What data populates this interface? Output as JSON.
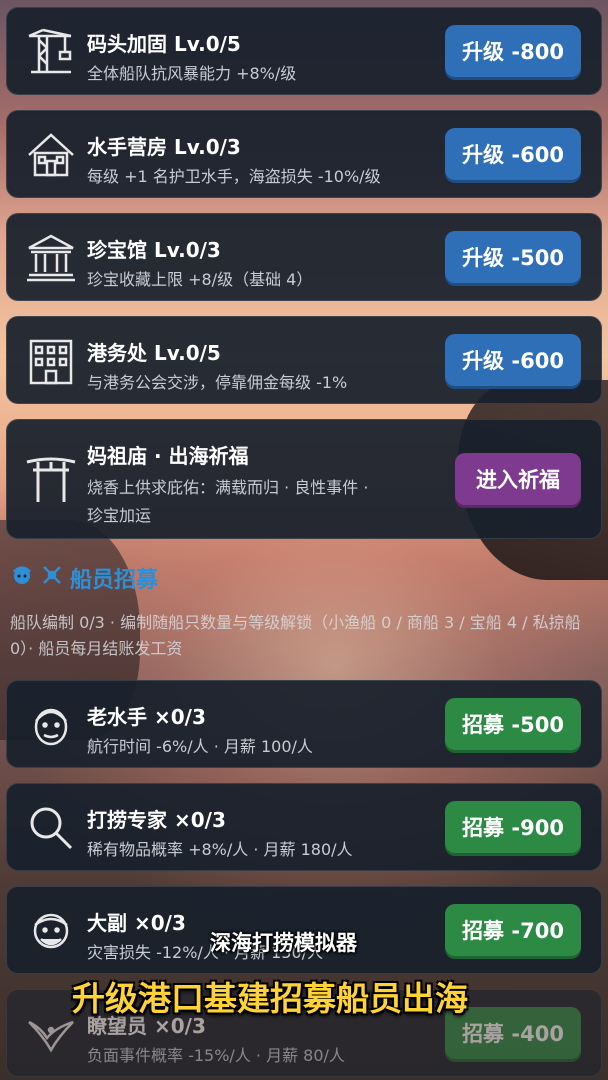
{
  "facilities": [
    {
      "icon": "crane-icon",
      "title": "码头加固 Lv.0/5",
      "desc": "全体船队抗风暴能力 +8%/级",
      "button": "升级 -800"
    },
    {
      "icon": "house-icon",
      "title": "水手营房 Lv.0/3",
      "desc": "每级 +1 名护卫水手，海盗损失 -10%/级",
      "button": "升级 -600"
    },
    {
      "icon": "museum-icon",
      "title": "珍宝馆 Lv.0/3",
      "desc": "珍宝收藏上限 +8/级（基础 4）",
      "button": "升级 -500"
    },
    {
      "icon": "office-building-icon",
      "title": "港务处 Lv.0/5",
      "desc": "与港务公会交涉，停靠佣金每级 -1%",
      "button": "升级 -600"
    }
  ],
  "temple": {
    "icon": "torii-gate-icon",
    "title": "妈祖庙 · 出海祈福",
    "desc_line1": "烧香上供求庇佑：满载而归 · 良性事件 ·",
    "desc_line2": "珍宝加运",
    "button": "进入祈福"
  },
  "crew_section": {
    "title": "船员招募",
    "desc": "船队编制 0/3 · 编制随船只数量与等级解锁（小渔船 0 / 商船 3 / 宝船 4 / 私掠船 0）· 船员每月结账发工资"
  },
  "crew": [
    {
      "icon": "sailor-face-icon",
      "title": "老水手 ×0/3",
      "desc": "航行时间 -6%/人 · 月薪 100/人",
      "button": "招募 -500"
    },
    {
      "icon": "magnifier-icon",
      "title": "打捞专家 ×0/3",
      "desc": "稀有物品概率 +8%/人 · 月薪 180/人",
      "button": "招募 -900"
    },
    {
      "icon": "mate-face-icon",
      "title": "大副 ×0/3",
      "desc": "灾害损失 -12%/人 · 月薪 150/人",
      "button": "招募 -700"
    },
    {
      "icon": "eagle-icon",
      "title": "瞭望员 ×0/3",
      "desc": "负面事件概率 -15%/人 · 月薪 80/人",
      "button": "招募 -400"
    }
  ],
  "overlay": {
    "game_title": "深海打捞模拟器",
    "caption": "升级港口基建招募船员出海"
  },
  "colors": {
    "blue_button": "#2f6fb8",
    "green_button": "#2c8a45",
    "purple_button": "#7d3a8e",
    "section_blue": "#2e8fd6",
    "caption_yellow": "#ffd335"
  }
}
